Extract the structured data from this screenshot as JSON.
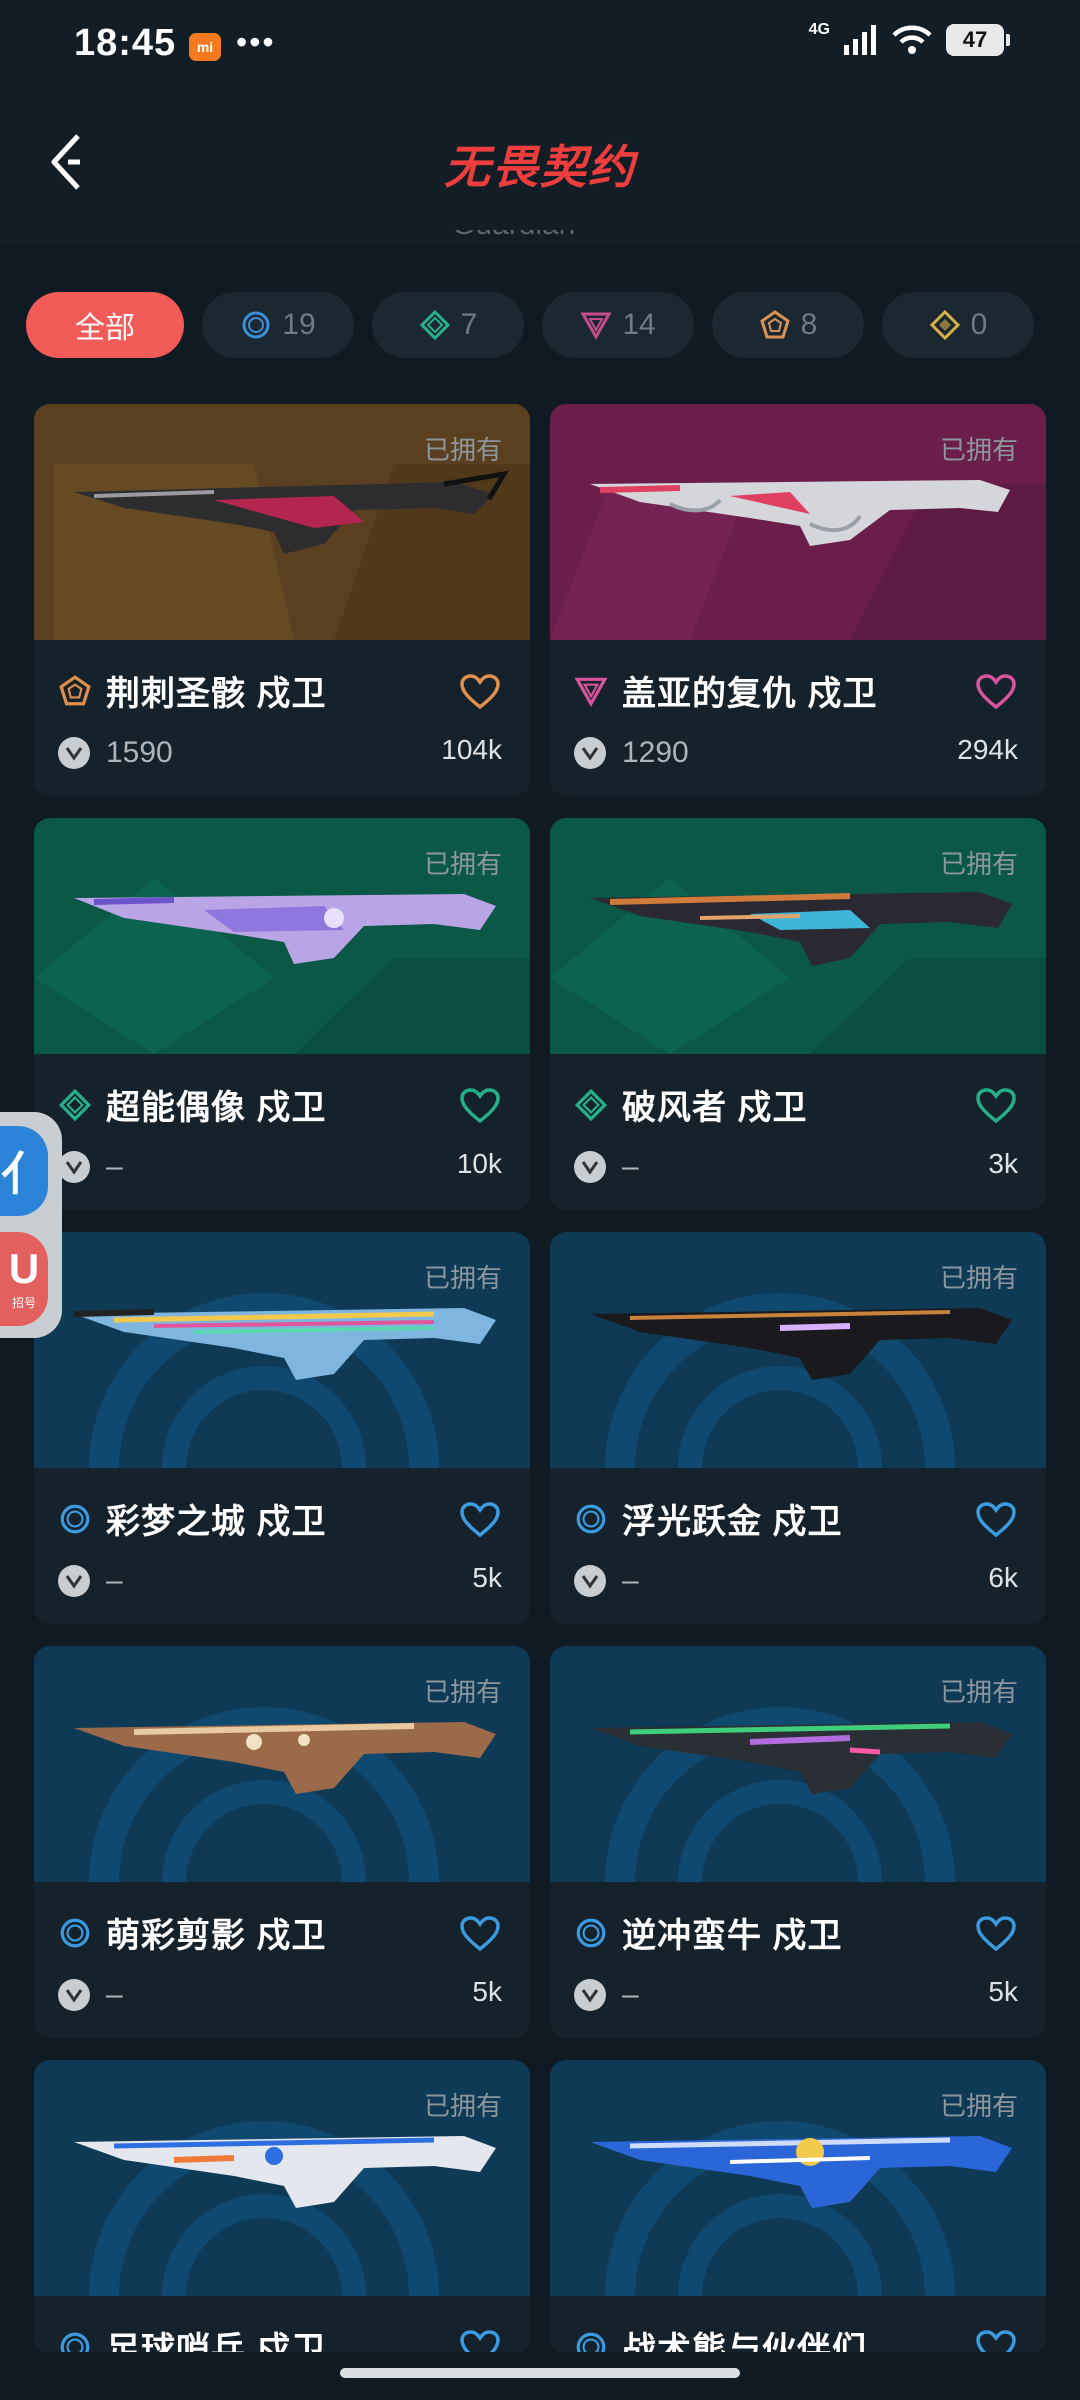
{
  "status_bar": {
    "time": "18:45",
    "app_badge": "mi",
    "more": "•••",
    "network": "4G",
    "battery": "47"
  },
  "header": {
    "logo_text": "无畏契约",
    "subtitle": "Guardian"
  },
  "filters": [
    {
      "label": "全部",
      "active": true,
      "tier": "all"
    },
    {
      "label": "19",
      "active": false,
      "tier": "select",
      "color": "#3b8fd6"
    },
    {
      "label": "7",
      "active": false,
      "tier": "deluxe",
      "color": "#27b08a"
    },
    {
      "label": "14",
      "active": false,
      "tier": "premium",
      "color": "#c44d8a"
    },
    {
      "label": "8",
      "active": false,
      "tier": "exclusive",
      "color": "#d99155"
    },
    {
      "label": "0",
      "active": false,
      "tier": "ultra",
      "color": "#d6b146"
    }
  ],
  "cards": [
    {
      "owned": "已拥有",
      "name": "荆刺圣骸 戍卫",
      "price": "1590",
      "likes": "104k",
      "tier_color": "#e08f4c",
      "heart_color": "#e08f4c",
      "bg_color": "#6a4a22"
    },
    {
      "owned": "已拥有",
      "name": "盖亚的复仇 戍卫",
      "price": "1290",
      "likes": "294k",
      "tier_color": "#d9559b",
      "heart_color": "#d9559b",
      "bg_color": "#6e1f4c"
    },
    {
      "owned": "已拥有",
      "name": "超能偶像 戍卫",
      "price": "–",
      "likes": "10k",
      "tier_color": "#24b18a",
      "heart_color": "#24b18a",
      "bg_color": "#0e5b4a"
    },
    {
      "owned": "已拥有",
      "name": "破风者 戍卫",
      "price": "–",
      "likes": "3k",
      "tier_color": "#24b18a",
      "heart_color": "#24b18a",
      "bg_color": "#0e5b4a"
    },
    {
      "owned": "已拥有",
      "name": "彩梦之城 戍卫",
      "price": "–",
      "likes": "5k",
      "tier_color": "#3b9be0",
      "heart_color": "#3b9be0",
      "bg_color": "#0f3d58"
    },
    {
      "owned": "已拥有",
      "name": "浮光跃金 戍卫",
      "price": "–",
      "likes": "6k",
      "tier_color": "#3b9be0",
      "heart_color": "#3b9be0",
      "bg_color": "#0f3d58"
    },
    {
      "owned": "已拥有",
      "name": "萌彩剪影 戍卫",
      "price": "–",
      "likes": "5k",
      "tier_color": "#3b9be0",
      "heart_color": "#3b9be0",
      "bg_color": "#0f3d58"
    },
    {
      "owned": "已拥有",
      "name": "逆冲蛮牛 戍卫",
      "price": "–",
      "likes": "5k",
      "tier_color": "#3b9be0",
      "heart_color": "#3b9be0",
      "bg_color": "#0f3d58"
    },
    {
      "owned": "已拥有",
      "name": "足球哨兵 戍卫",
      "price": "",
      "likes": "",
      "tier_color": "#3b9be0",
      "heart_color": "#3b9be0",
      "bg_color": "#0f3d58"
    },
    {
      "owned": "已拥有",
      "name": "战术熊与伙伴们",
      "price": "",
      "likes": "",
      "tier_color": "#3b9be0",
      "heart_color": "#3b9be0",
      "bg_color": "#0f3d58"
    }
  ],
  "side_float": {
    "top_glyph": "亻",
    "bottom_glyph": "U",
    "bottom_caption": "招号"
  }
}
